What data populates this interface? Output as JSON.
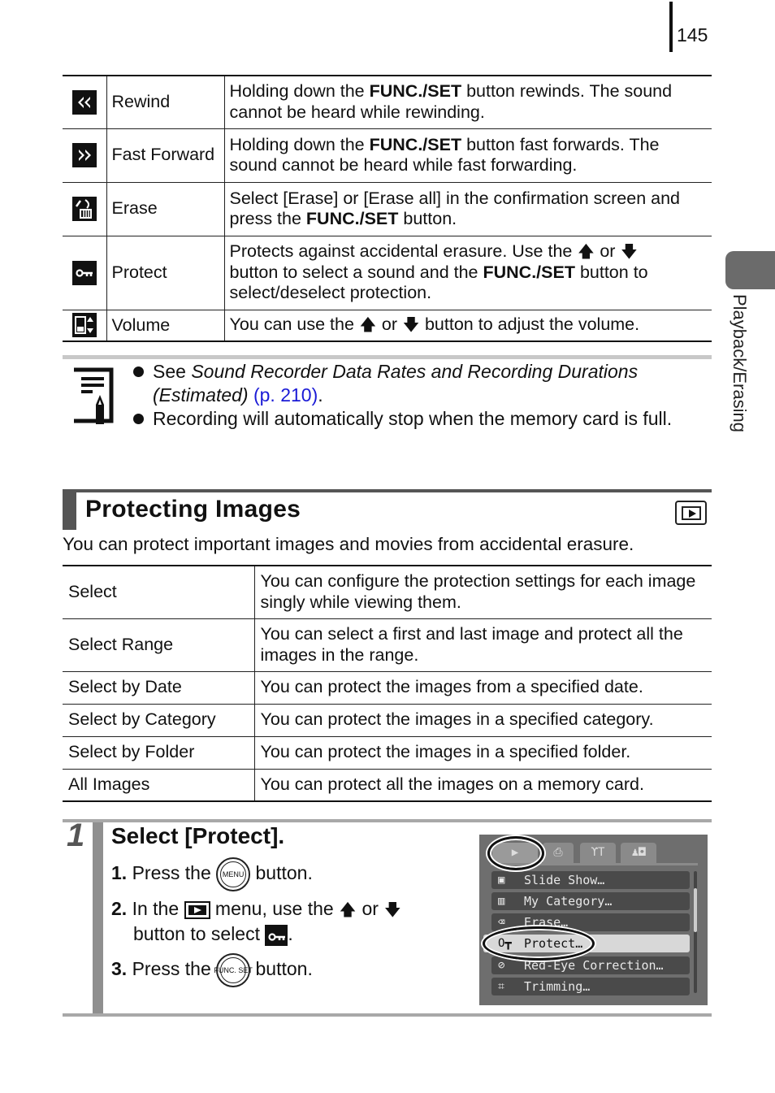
{
  "page": {
    "number": "145",
    "side_label": "Playback/Erasing"
  },
  "function_table": [
    {
      "icon": "rewind-icon",
      "name": "Rewind",
      "desc_before": "Holding down the ",
      "bold": "FUNC./SET",
      "desc_after": " button rewinds. The sound cannot be heard while rewinding."
    },
    {
      "icon": "fast-forward-icon",
      "name": "Fast Forward",
      "desc_before": "Holding down the ",
      "bold": "FUNC./SET",
      "desc_after": " button fast forwards. The sound cannot be heard while fast forwarding."
    },
    {
      "icon": "erase-icon",
      "name": "Erase",
      "desc_before": "Select [Erase] or [Erase all] in the confirmation screen and press the ",
      "bold": "FUNC./SET",
      "desc_after": " button."
    },
    {
      "icon": "protect-key-icon",
      "name": "Protect",
      "desc_a": "Protects against accidental erasure. Use the ",
      "or": "or",
      "desc_b": " button to select a sound and the ",
      "bold": "FUNC./SET",
      "desc_c": " button to select/deselect protection."
    },
    {
      "icon": "volume-icon",
      "name": "Volume",
      "desc_a": "You can use the ",
      "or": "or",
      "desc_b": " button to adjust the volume."
    }
  ],
  "note": {
    "items": [
      {
        "prefix": "See ",
        "italic": "Sound Recorder Data Rates and Recording Durations (Estimated)",
        "link": "(p. 210)",
        "suffix": "."
      },
      {
        "text": "Recording will automatically stop when the memory card is full."
      }
    ]
  },
  "section": {
    "title": "Protecting Images",
    "intro": "You can protect important images and movies from accidental erasure."
  },
  "options_table": [
    {
      "label": "Select",
      "desc": "You can configure the protection settings for each image singly while viewing them."
    },
    {
      "label": "Select Range",
      "desc": "You can select a first and last image and protect all the images in the range."
    },
    {
      "label": "Select by Date",
      "desc": "You can protect the images from a specified date."
    },
    {
      "label": "Select by Category",
      "desc": "You can protect the images in a specified category."
    },
    {
      "label": "Select by Folder",
      "desc": "You can protect the images in a specified folder."
    },
    {
      "label": "All Images",
      "desc": "You can protect all the images on a memory card."
    }
  ],
  "step": {
    "number": "1",
    "title": "Select [Protect].",
    "s1": {
      "num": "1.",
      "before": " Press the ",
      "btn": "MENU",
      "after": " button."
    },
    "s2": {
      "num": "2.",
      "before": " In the ",
      "mid": " menu, use the ",
      "or": "or",
      "line2": "button to select ",
      "end": "."
    },
    "s3": {
      "num": "3.",
      "before": " Press the ",
      "btn": "FUNC. SET",
      "after": " button."
    }
  },
  "lcd_menu": {
    "tabs": [
      "▶",
      "⎙",
      "ϒT",
      "♟◘"
    ],
    "items": [
      {
        "icon": "▣",
        "label": "Slide Show…"
      },
      {
        "icon": "▥",
        "label": "My Category…"
      },
      {
        "icon": "⌫",
        "label": "Erase…"
      },
      {
        "icon": "O┳",
        "label": "Protect…",
        "selected": true
      },
      {
        "icon": "⊘",
        "label": "Red-Eye Correction…"
      },
      {
        "icon": "⌗",
        "label": "Trimming…"
      }
    ]
  }
}
